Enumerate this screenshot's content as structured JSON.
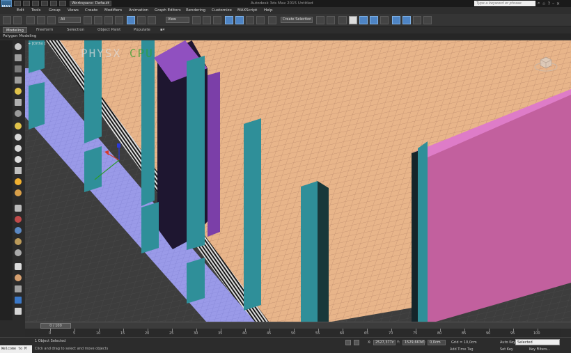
{
  "titlebar": {
    "logo": "MAX",
    "workspace": "Workspace: Default",
    "title": "Autodesk 3ds Max 2015    Untitled",
    "search_placeholder": "Type a keyword or phrase"
  },
  "menu": [
    "Edit",
    "Tools",
    "Group",
    "Views",
    "Create",
    "Modifiers",
    "Animation",
    "Graph Editors",
    "Rendering",
    "Customize",
    "MAXScript",
    "Help"
  ],
  "toolbar": {
    "filter_value": "All",
    "refcoord_value": "View",
    "selection_set_value": "Create Selection Se"
  },
  "ribbon": {
    "tabs": [
      "Modeling",
      "Freeform",
      "Selection",
      "Object Paint",
      "Populate"
    ],
    "sub_label": "Polygon Modeling"
  },
  "viewport": {
    "label": "+ [Ortho ]",
    "physx_prefix": "PHYSX",
    "physx_suffix": "CPU",
    "colors": {
      "floor": "#e8b58a",
      "teal": "#2f8f99",
      "walkway": "#9a9ae8",
      "magenta": "#d872c0",
      "purple": "#7b3fa8",
      "ground": "#3d3d3d"
    }
  },
  "timeline": {
    "slider_text": "0 / 100",
    "ticks": [
      "0",
      "5",
      "10",
      "15",
      "20",
      "25",
      "30",
      "35",
      "40",
      "45",
      "50",
      "55",
      "60",
      "65",
      "70",
      "75",
      "80",
      "85",
      "90",
      "95",
      "100"
    ]
  },
  "status": {
    "objects": "1 Object Selected",
    "prompt": "Click and drag to select and move objects",
    "welcome": "Welcome to M",
    "x_label": "X:",
    "x_value": "2527,377c",
    "y_label": "Y:",
    "y_value": "1529,663c",
    "z_label": "Z:",
    "z_value": "0,0cm",
    "grid": "Grid = 10,0cm",
    "add_time_tag": "Add Time Tag",
    "auto_key": "Auto Key",
    "auto_key_select": "Selected",
    "set_key": "Set Key",
    "key_filters": "Key Filters..."
  }
}
